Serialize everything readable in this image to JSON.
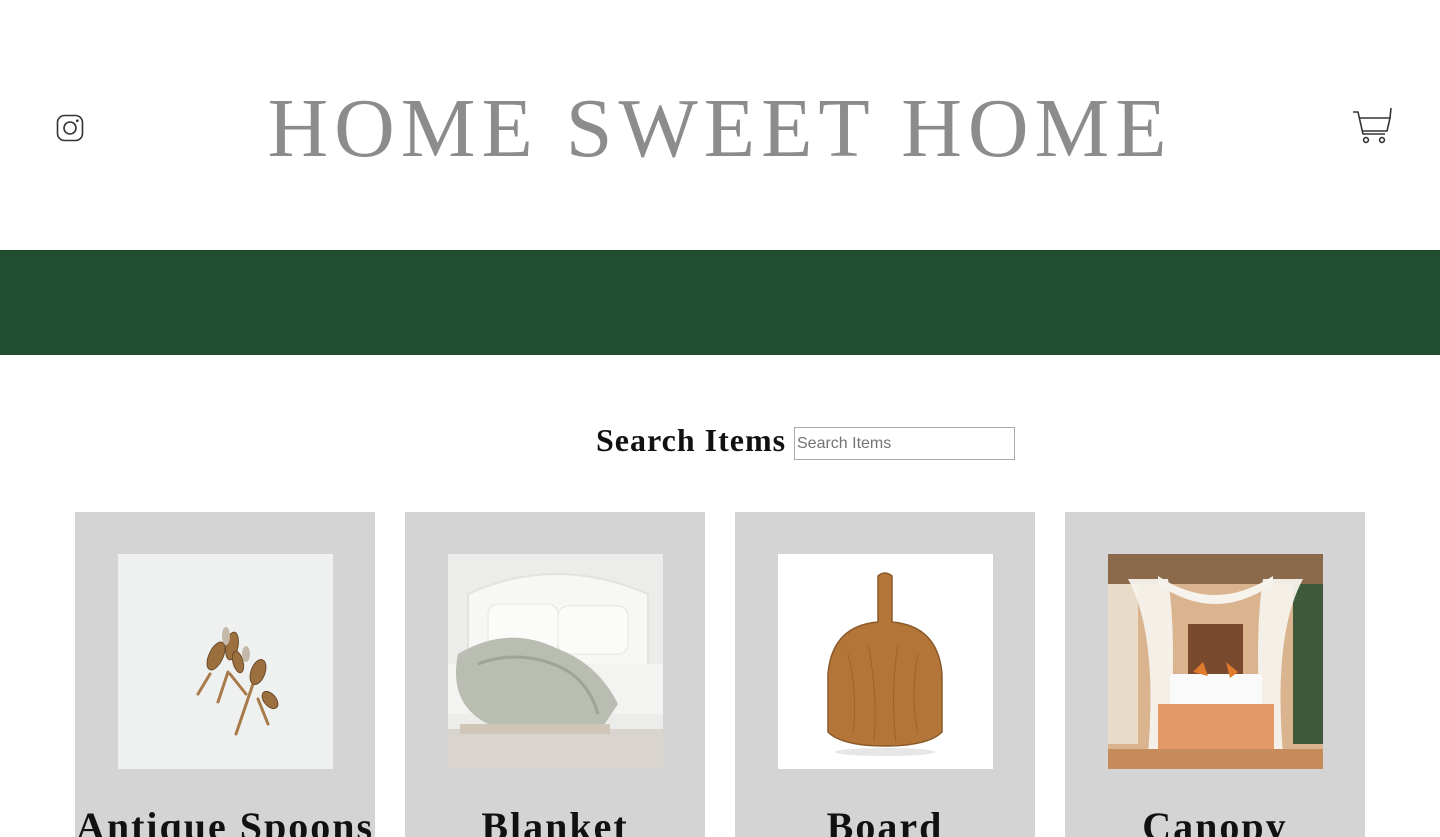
{
  "header": {
    "title": "HOME SWEET HOME",
    "instagram_icon": "instagram-icon",
    "cart_icon": "shopping-cart-icon"
  },
  "banner": {
    "color": "#214e31"
  },
  "search": {
    "label": "Search Items",
    "placeholder": "Search Items",
    "value": ""
  },
  "products": [
    {
      "name": "Antique Spoons",
      "image": "antique-spoons-photo"
    },
    {
      "name": "Blanket",
      "image": "blanket-on-bed-photo"
    },
    {
      "name": "Board",
      "image": "wooden-cutting-board-photo"
    },
    {
      "name": "Canopy",
      "image": "canopy-bed-photo"
    }
  ],
  "colors": {
    "title_gray": "#8c8c8c",
    "card_bg": "#d4d4d4",
    "accent_green": "#214e31"
  }
}
